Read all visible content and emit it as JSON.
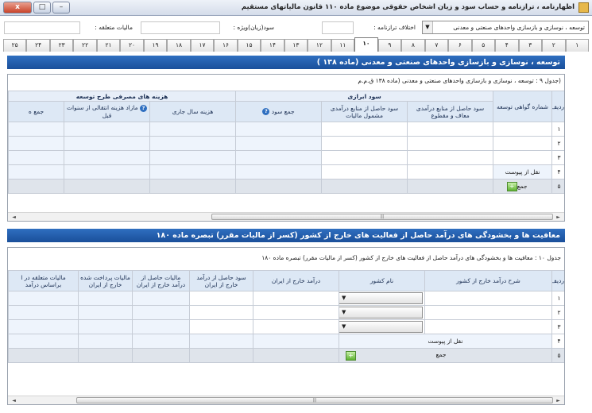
{
  "window": {
    "title": "اظهارنامه ، ترازنامه و حساب سود و زیان اشخاص حقوقی موضوع ماده ۱۱۰ قانون مالیاتهای مستقیم",
    "close_label": "x",
    "maximize_label": "□",
    "minimize_label": "–"
  },
  "topbar": {
    "dropdown_value": "توسعه ، نوسازی و بازسازی واحدهای صنعتی و معدنی",
    "dropdown_caret": "▼",
    "discrepancy_label": "اختلاف ترازنامه :",
    "special_profit_label": "سود(زیان)ویژه :",
    "tax_label": "مالیات متعلقه :"
  },
  "tabs": [
    "۱",
    "۲",
    "۳",
    "۴",
    "۵",
    "۶",
    "۷",
    "۸",
    "۹",
    "۱۰",
    "۱۱",
    "۱۲",
    "۱۳",
    "۱۴",
    "۱۵",
    "۱۶",
    "۱۷",
    "۱۸",
    "۱۹",
    "۲۰",
    "۲۱",
    "۲۲",
    "۲۳",
    "۲۴",
    "۲۵"
  ],
  "active_tab": "۱۰",
  "section1": {
    "header": "توسعه ، نوسازی و بازسازی واحدهای صنعتی و معدنی (ماده ۱۳۸ )",
    "caption": "(جدول ۹ : توسعه ، نوسازی و بازسازی واحدهای صنعتی و معدنی (ماده ۱۳۸ ق.م.م",
    "col_row": "ردیف",
    "col_cert": "شماره گواهی توسعه",
    "group_profit": "سود ابرازی",
    "group_cost": "هزینه های مصرفی طرح توسعه",
    "col_exempt": "سود حاصل از منابع درآمدی معاف و مقطوع",
    "col_taxable": "سود حاصل از منابع درآمدی مشمول مالیات",
    "col_total_profit": "جمع سود",
    "col_current_year": "هزینه سال جاری",
    "col_prev_years": "مازاد هزینه انتقالی از سنوات قبل",
    "col_total": "جمع ه",
    "help": "?",
    "rows": [
      "۱",
      "۲",
      "۳",
      "۴",
      "۵"
    ],
    "carry_label": "نقل از پیوست",
    "sum_label": "جمع",
    "add": "+",
    "scroll_left": "◄",
    "scroll_right": "►",
    "grip": "|||"
  },
  "section2": {
    "header": "معافیت ها و بخشودگی های درآمد حاصل از فعالیت های خارج از کشور (کسر از مالیات مقرر) تبصره ماده ۱۸۰",
    "caption": "جدول ۱۰ : معافیت ها و بخشودگی های درآمد حاصل از فعالیت های خارج از کشور (کسر از مالیات مقرر) تبصره ماده ۱۸۰",
    "col_row": "ردیف",
    "col_desc": "شرح درآمد خارج از کشور",
    "col_country": "نام کشور",
    "col_income_iran": "درآمد خارج از ایران",
    "col_profit_abroad": "سود حاصل از درآمد خارج از ایران",
    "col_tax_abroad": "مالیات حاصل از درآمد خارج از ایران",
    "col_tax_paid": "مالیات پرداخت شده خارج از ایران",
    "col_tax_due": "مالیات متعلقه در ا براساس درآمد",
    "rows": [
      "۱",
      "۲",
      "۳",
      "۴",
      "۵"
    ],
    "carry_label": "نقل از پیوست",
    "sum_label": "جمع",
    "select_caret": "▼",
    "add": "+",
    "scroll_left": "◄",
    "scroll_right": "►",
    "grip": "|||"
  }
}
